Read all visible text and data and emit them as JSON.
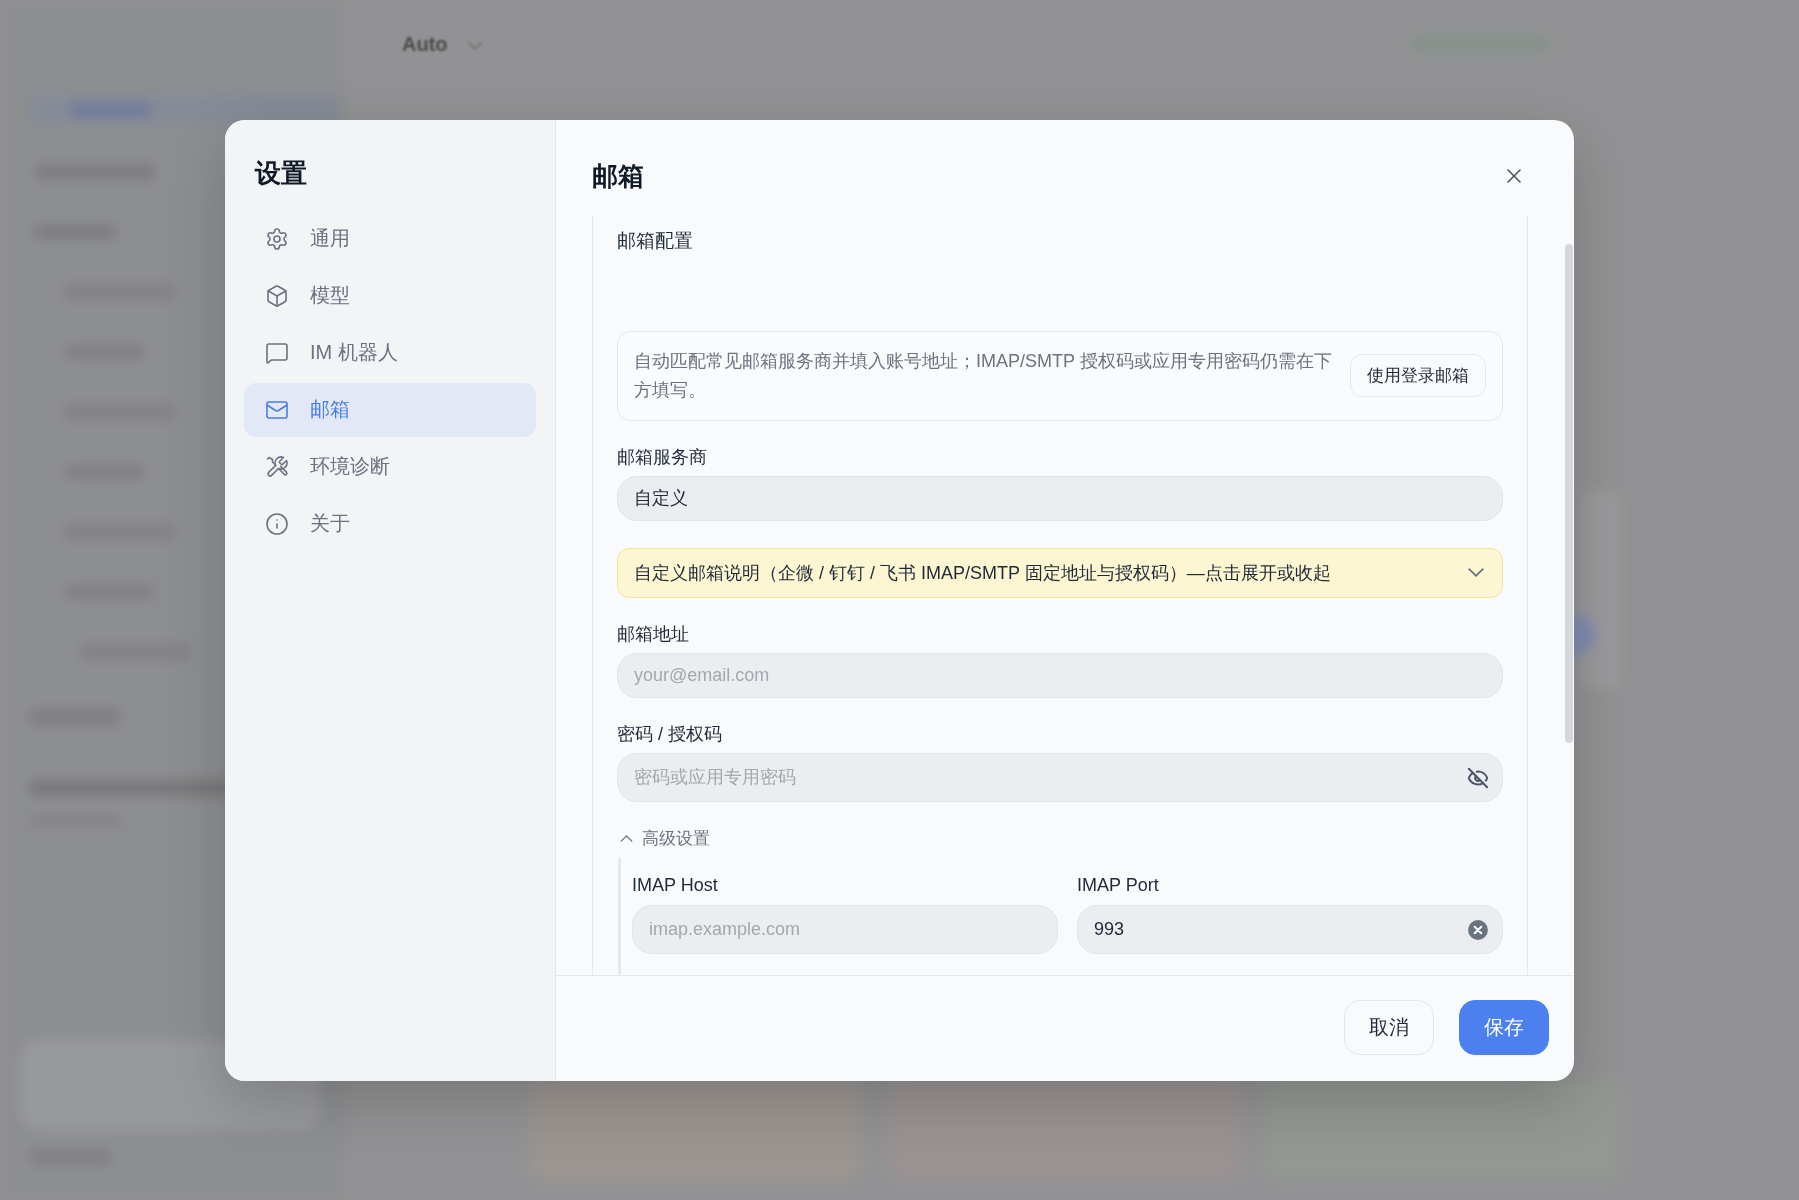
{
  "backdrop": {
    "model_label": "Auto"
  },
  "dialog": {
    "sidebar": {
      "title": "设置",
      "items": [
        {
          "label": "通用",
          "kind": "general",
          "selected": false
        },
        {
          "label": "模型",
          "kind": "model",
          "selected": false
        },
        {
          "label": "IM 机器人",
          "kind": "im",
          "selected": false
        },
        {
          "label": "邮箱",
          "kind": "mail",
          "selected": true
        },
        {
          "label": "环境诊断",
          "kind": "diagnostics",
          "selected": false
        },
        {
          "label": "关于",
          "kind": "about",
          "selected": false
        }
      ]
    },
    "title": "邮箱",
    "section": {
      "title": "邮箱配置",
      "notice": {
        "text": "自动匹配常见邮箱服务商并填入账号地址；IMAP/SMTP 授权码或应用专用密码仍需在下方填写。",
        "button": "使用登录邮箱"
      },
      "provider": {
        "label": "邮箱服务商",
        "value": "自定义"
      },
      "help": {
        "text": "自定义邮箱说明（企微 / 钉钉 / 飞书 IMAP/SMTP 固定地址与授权码）—点击展开或收起",
        "expanded": false
      },
      "email": {
        "label": "邮箱地址",
        "placeholder": "your@email.com"
      },
      "password": {
        "label": "密码 / 授权码",
        "placeholder": "密码或应用专用密码",
        "visible": false
      },
      "advanced": {
        "label": "高级设置",
        "expanded": true,
        "fields": [
          {
            "label": "IMAP Host",
            "placeholder": "imap.example.com"
          },
          {
            "label": "IMAP Port",
            "value": "993"
          }
        ]
      }
    },
    "buttons": {
      "cancel": "取消",
      "save": "保存"
    }
  }
}
